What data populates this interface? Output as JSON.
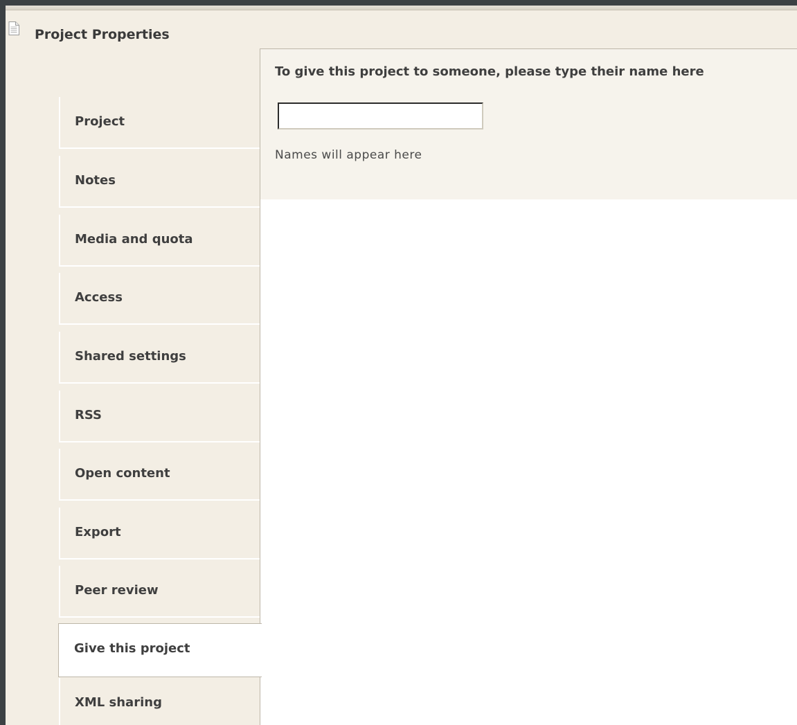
{
  "window": {
    "title": "Project Properties"
  },
  "tabs": [
    {
      "label": "Project",
      "active": false
    },
    {
      "label": "Notes",
      "active": false
    },
    {
      "label": "Media and quota",
      "active": false
    },
    {
      "label": "Access",
      "active": false
    },
    {
      "label": "Shared settings",
      "active": false
    },
    {
      "label": "RSS",
      "active": false
    },
    {
      "label": "Open content",
      "active": false
    },
    {
      "label": "Export",
      "active": false
    },
    {
      "label": "Peer review",
      "active": false
    },
    {
      "label": "Give this project",
      "active": true
    },
    {
      "label": "XML sharing",
      "active": false
    }
  ],
  "give_panel": {
    "heading": "To give this project to someone, please type their name here",
    "name_input_value": "",
    "names_hint": "Names will appear here"
  },
  "icons": {
    "title_icon": "document-icon"
  }
}
